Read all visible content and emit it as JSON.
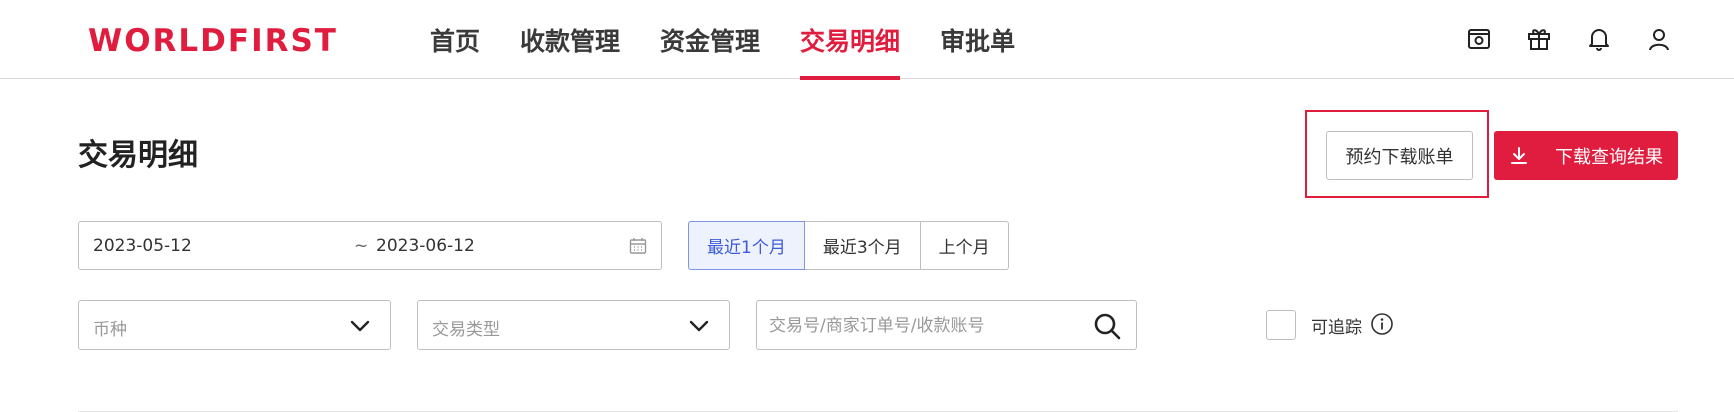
{
  "header": {
    "logo": "WORLDFIRST",
    "nav": [
      {
        "label": "首页",
        "active": false
      },
      {
        "label": "收款管理",
        "active": false
      },
      {
        "label": "资金管理",
        "active": false
      },
      {
        "label": "交易明细",
        "active": true
      },
      {
        "label": "审批单",
        "active": false
      }
    ],
    "icons": [
      "inbox-icon",
      "gift-icon",
      "bell-icon",
      "user-icon"
    ]
  },
  "page": {
    "title": "交易明细",
    "schedule_download_label": "预约下载账单",
    "download_results_label": "下载查询结果"
  },
  "filters": {
    "date_start": "2023-05-12",
    "date_separator": "~",
    "date_end": "2023-06-12",
    "quick_ranges": [
      {
        "label": "最近1个月",
        "active": true
      },
      {
        "label": "最近3个月",
        "active": false
      },
      {
        "label": "上个月",
        "active": false
      }
    ],
    "currency_placeholder": "币种",
    "type_placeholder": "交易类型",
    "search_placeholder": "交易号/商家订单号/收款账号",
    "traceable_label": "可追踪",
    "traceable_checked": false
  },
  "colors": {
    "brand": "#e01d3e",
    "active_range_bg": "#eef2fd",
    "active_range_text": "#3d5bd9"
  }
}
